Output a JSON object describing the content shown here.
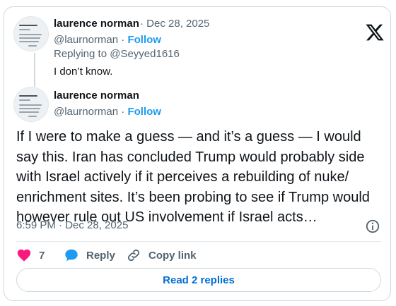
{
  "reply_tweet": {
    "author_name": "laurence norman",
    "separator": "·",
    "date": "Dec 28, 2025",
    "handle": "@laurnorman",
    "follow_label": "Follow",
    "replying_to": "Replying to @Seyyed1616",
    "text": "I don’t know."
  },
  "main_tweet": {
    "author_name": "laurence norman",
    "handle": "@laurnorman",
    "separator": "·",
    "follow_label": "Follow",
    "body": "If I were to make a guess — and it’s a guess — I would say this. Iran has concluded Trump would probably side with Israel actively if it perceives a rebuilding of nuke/ enrichment sites. It’s been probing to see if Trump would however rule out US involvement if Israel acts…",
    "timestamp": "6:59 PM · Dec 28, 2025"
  },
  "actions": {
    "like_count": "7",
    "reply_label": "Reply",
    "copy_link_label": "Copy link"
  },
  "read_replies_label": "Read 2 replies",
  "colors": {
    "like": "#f91880",
    "reply": "#1d9bf0",
    "link": "#006fd6",
    "follow": "#1d9bf0"
  },
  "icons": [
    "x-logo-icon",
    "info-icon",
    "heart-icon",
    "reply-bubble-icon",
    "link-icon"
  ]
}
